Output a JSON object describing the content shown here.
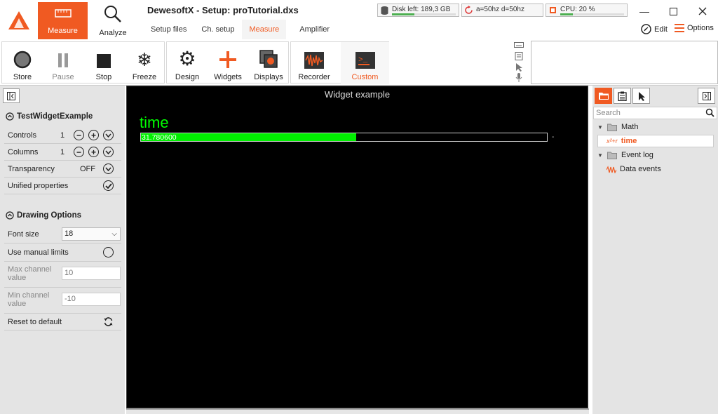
{
  "app": {
    "title": "DewesoftX - Setup: proTutorial.dxs"
  },
  "modes": [
    {
      "label": "Measure",
      "active": true,
      "icon": "measure-icon"
    },
    {
      "label": "Analyze",
      "active": false,
      "icon": "magnifier-icon"
    }
  ],
  "subtabs": [
    {
      "label": "Setup files",
      "active": false
    },
    {
      "label": "Ch. setup",
      "active": false
    },
    {
      "label": "Measure",
      "active": true
    },
    {
      "label": "Amplifier",
      "active": false
    }
  ],
  "status": {
    "disk": {
      "label": "Disk left: 189,3 GB",
      "fill": 0.35
    },
    "sync": {
      "label": "a=50hz d=50hz"
    },
    "cpu": {
      "label": "CPU: 20 %",
      "fill": 0.2
    }
  },
  "window": {
    "edit_label": "Edit",
    "options_label": "Options"
  },
  "toolbar": {
    "store": "Store",
    "pause": "Pause",
    "stop": "Stop",
    "freeze": "Freeze",
    "design": "Design",
    "widgets": "Widgets",
    "displays": "Displays",
    "recorder": "Recorder",
    "custom": "Custom"
  },
  "left_panel": {
    "section1_title": "TestWidgetExample",
    "controls_label": "Controls",
    "controls_value": "1",
    "columns_label": "Columns",
    "columns_value": "1",
    "transparency_label": "Transparency",
    "transparency_value": "OFF",
    "unified_label": "Unified properties",
    "unified_checked": true,
    "section2_title": "Drawing Options",
    "font_size_label": "Font size",
    "font_size_value": "18",
    "manual_limits_label": "Use manual limits",
    "max_label": "Max channel value",
    "max_value": "10",
    "min_label": "Min channel value",
    "min_value": "-10",
    "reset_label": "Reset to default"
  },
  "display": {
    "title": "Widget example",
    "channel_name": "time",
    "channel_value": "31.780600",
    "bar_fraction": 0.53,
    "bar_color": "#00ee00",
    "suffix": "-"
  },
  "right_panel": {
    "search_placeholder": "Search",
    "tree": [
      {
        "label": "Math",
        "type": "group"
      },
      {
        "label": "time",
        "type": "channel",
        "selected": true
      },
      {
        "label": "Event log",
        "type": "group"
      },
      {
        "label": "Data events",
        "type": "channel"
      }
    ]
  },
  "colors": {
    "accent": "#f05a22",
    "value_green": "#00ff00"
  }
}
